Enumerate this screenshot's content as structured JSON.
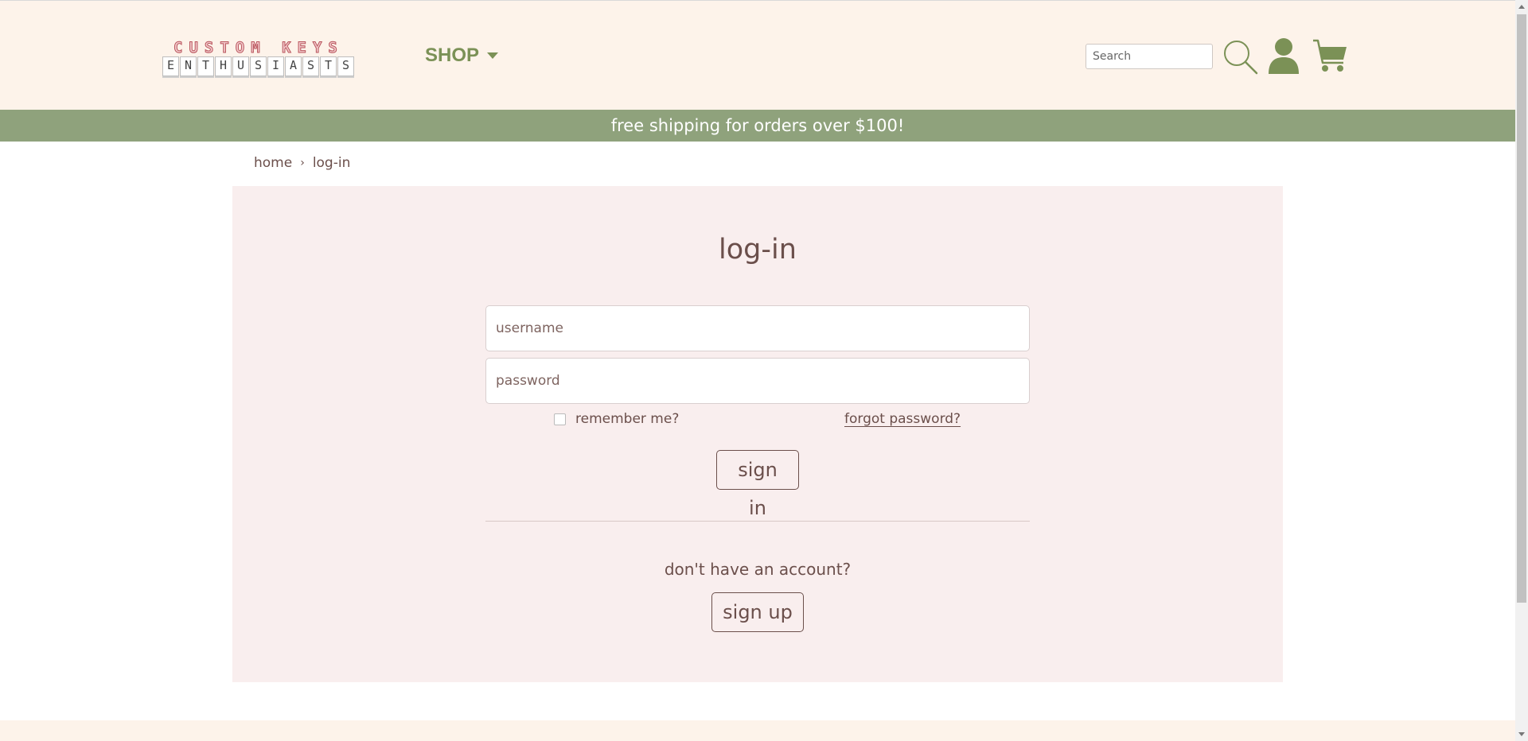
{
  "header": {
    "logo": {
      "top_text": "CUSTOM KEYS",
      "keys": [
        "E",
        "N",
        "T",
        "H",
        "U",
        "S",
        "I",
        "A",
        "S",
        "T",
        "S"
      ]
    },
    "shop_label": "SHOP",
    "search_placeholder": "Search",
    "icons": {
      "search": "search-icon",
      "user": "user-icon",
      "cart": "cart-icon"
    },
    "accent_color": "#7b9156"
  },
  "banner": {
    "text": "free shipping for orders over $100!",
    "color": "#8fa27c"
  },
  "breadcrumb": {
    "home": "home",
    "separator": "›",
    "current": "log-in"
  },
  "login": {
    "title": "log-in",
    "username_placeholder": "username",
    "password_placeholder": "password",
    "remember_label": "remember me?",
    "forgot_label": "forgot password?",
    "signin_label": "sign in",
    "no_account_text": "don't have an account?",
    "signup_label": "sign up",
    "panel_color": "#f9eeee"
  }
}
